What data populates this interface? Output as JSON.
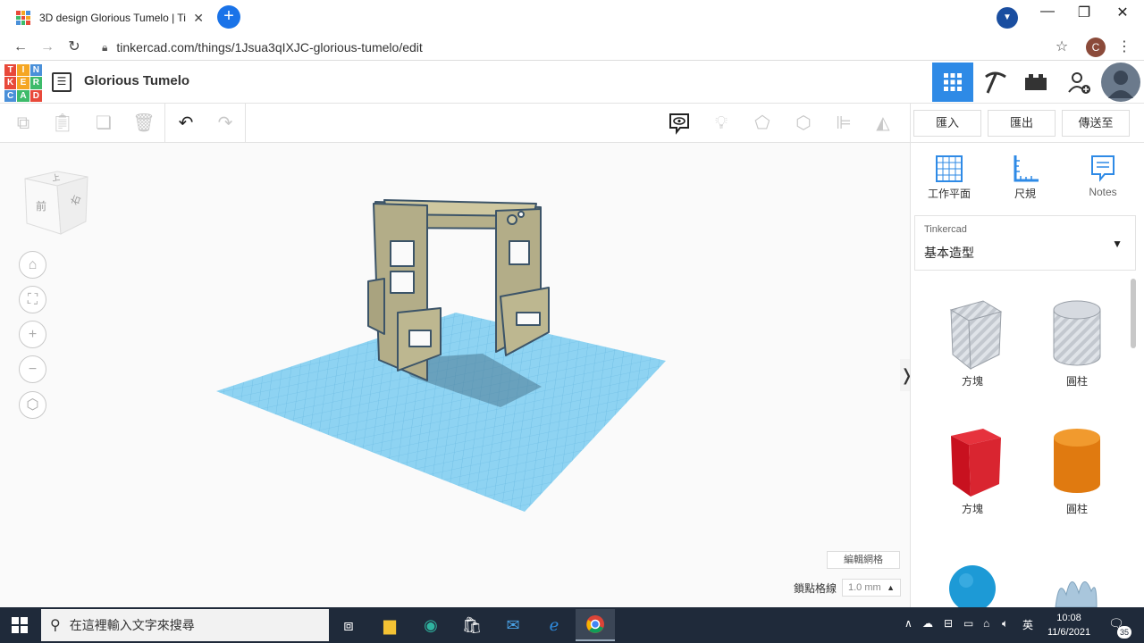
{
  "browser": {
    "tab_title": "3D design Glorious Tumelo | Ti",
    "url": "tinkercad.com/things/1Jsua3qIXJC-glorious-tumelo/edit",
    "profile_initial": "C"
  },
  "app": {
    "logo_letters": [
      "T",
      "I",
      "N",
      "K",
      "E",
      "R",
      "C",
      "A",
      "D"
    ],
    "logo_colors": [
      "#e8493a",
      "#f5a623",
      "#4a90d9",
      "#e8493a",
      "#f5a623",
      "#3dbb6a",
      "#4a90d9",
      "#3dbb6a",
      "#e8493a"
    ],
    "design_name": "Glorious Tumelo",
    "accent": "#2e8ae6"
  },
  "toolbar": {
    "import_label": "匯入",
    "export_label": "匯出",
    "sendto_label": "傳送至"
  },
  "viewcube": {
    "front_label": "前",
    "right_label": "右",
    "top_label": "上"
  },
  "canvas": {
    "edit_grid_label": "編輯網格",
    "snap_grid_label": "鎖點格線",
    "snap_grid_value": "1.0 mm"
  },
  "panel": {
    "workplane_label": "工作平面",
    "ruler_label": "尺規",
    "notes_label": "Notes",
    "library_source": "Tinkercad",
    "library_category": "基本造型",
    "shapes": [
      {
        "label": "方塊",
        "icon": "box-hole-icon"
      },
      {
        "label": "圓柱",
        "icon": "cylinder-hole-icon"
      },
      {
        "label": "方塊",
        "icon": "box-red-icon"
      },
      {
        "label": "圓柱",
        "icon": "cylinder-orange-icon"
      }
    ]
  },
  "taskbar": {
    "search_placeholder": "在這裡輸入文字來搜尋",
    "ime_label": "英",
    "time": "10:08",
    "date": "11/6/2021",
    "notification_count": "35"
  }
}
